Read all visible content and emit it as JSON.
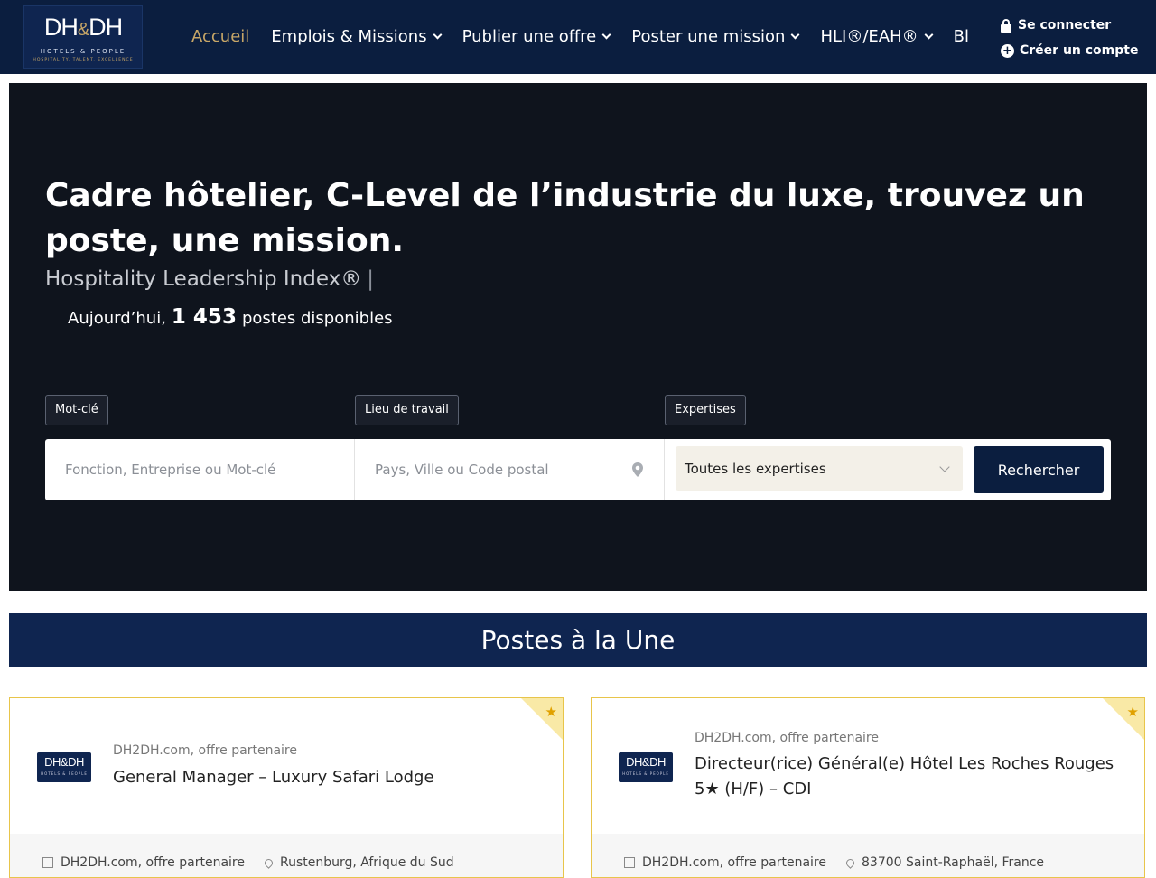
{
  "header": {
    "logo": {
      "mark_left": "DH",
      "mark_amp": "&",
      "mark_right": "DH",
      "sub1": "HOTELS & PEOPLE",
      "sub2": "HOSPITALITY. TALENT. EXCELLENCE"
    },
    "nav": [
      {
        "label": "Accueil",
        "active": true,
        "dropdown": false
      },
      {
        "label": "Emplois & Missions",
        "active": false,
        "dropdown": true
      },
      {
        "label": "Publier une offre",
        "active": false,
        "dropdown": true
      },
      {
        "label": "Poster une mission",
        "active": false,
        "dropdown": true
      },
      {
        "label": "HLI®/EAH®",
        "active": false,
        "dropdown": true
      },
      {
        "label": "Bl",
        "active": false,
        "dropdown": false
      }
    ],
    "login_label": "Se connecter",
    "register_label": "Créer un compte"
  },
  "hero": {
    "title": "Cadre hôtelier, C-Level de l’industrie du luxe, trouvez un poste, une mission.",
    "subtitle": "Hospitality Leadership Index®",
    "subtitle_caret": "|",
    "count_prefix": "Aujourd’hui,",
    "count_value": "1 453",
    "count_suffix": "postes disponibles"
  },
  "search": {
    "keyword_label": "Mot-clé",
    "keyword_placeholder": "Fonction, Entreprise ou Mot-clé",
    "location_label": "Lieu de travail",
    "location_placeholder": "Pays, Ville ou Code postal",
    "expertise_label": "Expertises",
    "expertise_selected": "Toutes les expertises",
    "button_label": "Rechercher"
  },
  "featured": {
    "title": "Postes à la Une",
    "jobs": [
      {
        "company": "DH2DH.com, offre partenaire",
        "title": "General Manager – Luxury Safari Lodge",
        "meta_company": "DH2DH.com, offre partenaire",
        "meta_location": "Rustenburg, Afrique du Sud"
      },
      {
        "company": "DH2DH.com, offre partenaire",
        "title": "Directeur(rice) Général(e) Hôtel Les Roches Rouges 5★ (H/F) – CDI",
        "meta_company": "DH2DH.com, offre partenaire",
        "meta_location": "83700 Saint-Raphaël, France"
      }
    ]
  },
  "colors": {
    "navy": "#0b1e3f",
    "gold": "#c7a667",
    "hero_bg": "#0f141d",
    "card_border": "#e8c54a"
  }
}
